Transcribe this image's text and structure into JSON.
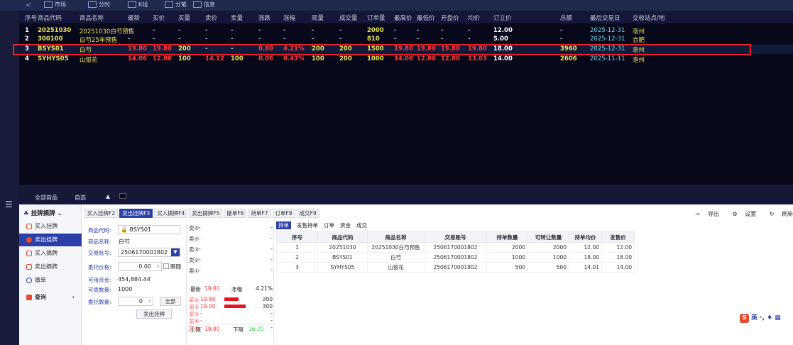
{
  "top_tabs": {
    "back": "<",
    "tab1": "市场",
    "tab2": "分时",
    "tab3": "K线",
    "tab4": "分笔",
    "tab5": "信息"
  },
  "quote_table": {
    "headers": [
      "序号",
      "商品代码",
      "商品名称",
      "最新",
      "买价",
      "买量",
      "卖价",
      "卖量",
      "涨跌",
      "涨幅",
      "现量",
      "成交量",
      "订单量",
      "最高价",
      "最低价",
      "开盘价",
      "均价",
      "订立价",
      "总额",
      "最后交易日",
      "交收站点/地"
    ],
    "rows": [
      [
        "1",
        "20251030",
        "20251030白芍预售",
        "-",
        "-",
        "-",
        "-",
        "-",
        "-",
        "-",
        "-",
        "-",
        "2000",
        "-",
        "-",
        "-",
        "-",
        "12.00",
        "-",
        "2025-12-31",
        "亳州"
      ],
      [
        "2",
        "300100",
        "白芍25年预售",
        "-",
        "-",
        "-",
        "-",
        "-",
        "-",
        "-",
        "-",
        "-",
        "810",
        "-",
        "-",
        "-",
        "-",
        "5.00",
        "-",
        "2025-12-31",
        "合肥"
      ],
      [
        "3",
        "BSYS01",
        "白芍",
        "19.80",
        "19.80",
        "200",
        "-",
        "-",
        "0.80",
        "4.21%",
        "200",
        "200",
        "1500",
        "19.80",
        "19.80",
        "19.80",
        "19.80",
        "18.00",
        "3960",
        "2025-12-31",
        "亳州"
      ],
      [
        "4",
        "SYHYS05",
        "山银花",
        "14.06",
        "12.00",
        "100",
        "14.12",
        "100",
        "0.06",
        "0.43%",
        "100",
        "200",
        "1000",
        "14.06",
        "12.00",
        "12.00",
        "13.03",
        "14.00",
        "2606",
        "2025-11-11",
        "亳州"
      ]
    ]
  },
  "mid_bar": {
    "all": "全部商品",
    "self": "自选",
    "arrow": "▲"
  },
  "left_menu": {
    "title": "挂牌摘牌",
    "items": [
      "买入挂牌",
      "卖出挂牌",
      "买入摘牌",
      "卖出摘牌",
      "撤单",
      "查询"
    ]
  },
  "order_tabs": [
    "买入挂牌F2",
    "卖出挂牌F3",
    "买入摘牌F4",
    "卖出摘牌F5",
    "撤单F6",
    "持单F7",
    "订单F8",
    "成交F9"
  ],
  "right_tools": [
    "导出",
    "设置",
    "刷新"
  ],
  "form": {
    "code_label": "商品代码:",
    "code_value": "BSYS01",
    "name_label": "商品名称:",
    "name_value": "白芍",
    "account_label": "交易账号:",
    "account_value": "2506170001802",
    "price_label": "委托价格:",
    "price_value": "0.00",
    "follow": "跟随",
    "funds_label": "可用资金:",
    "funds_value": "454,884.44",
    "qty_avail_label": "可卖数量:",
    "qty_avail_value": "1000",
    "qty_label": "委托数量:",
    "qty_value": "0",
    "all_btn": "全部",
    "submit": "卖出挂牌"
  },
  "orderbook": {
    "sells": [
      {
        "label": "卖⑤",
        "price": "-",
        "vol": "-"
      },
      {
        "label": "卖④",
        "price": "-",
        "vol": "-"
      },
      {
        "label": "卖③",
        "price": "-",
        "vol": "-"
      },
      {
        "label": "卖②",
        "price": "-",
        "vol": "-"
      },
      {
        "label": "卖①",
        "price": "-",
        "vol": "-"
      }
    ],
    "last_label": "最新",
    "last": "19.80",
    "chg_label": "涨幅",
    "chg": "4.21%",
    "buys": [
      {
        "label": "买①",
        "price": "19.80",
        "vol": "200",
        "bar": 0.67
      },
      {
        "label": "买②",
        "price": "19.00",
        "vol": "300",
        "bar": 1.0
      },
      {
        "label": "买③",
        "price": "-",
        "vol": "-",
        "bar": 0
      },
      {
        "label": "买④",
        "price": "-",
        "vol": "-",
        "bar": 0
      },
      {
        "label": "买⑤",
        "price": "-",
        "vol": "-",
        "bar": 0
      }
    ],
    "upper_label": "上限",
    "upper": "19.80",
    "lower_label": "下限",
    "lower": "16.20"
  },
  "hold_tabs": [
    "持单",
    "发售持单",
    "订单",
    "资金",
    "成交"
  ],
  "hold_table": {
    "headers": [
      "序号",
      "商品代码",
      "商品名称",
      "交易账号",
      "持单数量",
      "可转让数量",
      "持单均价",
      "发售价"
    ],
    "rows": [
      [
        "1",
        "20251030",
        "20251030白芍预售",
        "2506170001802",
        "2000",
        "2000",
        "12.00",
        "12.00"
      ],
      [
        "2",
        "BSYS01",
        "白芍",
        "2506170001802",
        "1000",
        "1000",
        "18.00",
        "18.00"
      ],
      [
        "3",
        "SYHYS05",
        "山银花",
        "2506170001802",
        "500",
        "500",
        "14.01",
        "14.00"
      ]
    ]
  },
  "ime": {
    "s": "S",
    "text": "英 ·, ♦ ▦"
  }
}
